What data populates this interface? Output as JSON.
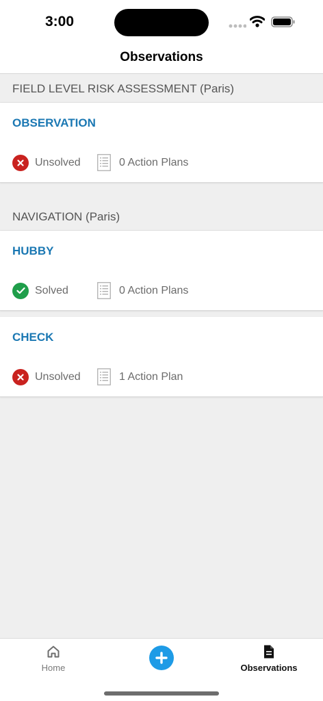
{
  "status_bar": {
    "time": "3:00"
  },
  "header": {
    "title": "Observations"
  },
  "colors": {
    "accent": "#1b78b3",
    "unsolved": "#c9221f",
    "solved": "#1f9e4a",
    "add_button": "#1e9be6"
  },
  "sections": [
    {
      "header": "FIELD LEVEL RISK ASSESSMENT (Paris)",
      "items": [
        {
          "title": "OBSERVATION",
          "status": "Unsolved",
          "status_icon": "x-circle-icon",
          "plans": "0 Action Plans"
        }
      ]
    },
    {
      "header": "NAVIGATION (Paris)",
      "items": [
        {
          "title": "HUBBY",
          "status": "Solved",
          "status_icon": "check-circle-icon",
          "plans": "0 Action Plans"
        },
        {
          "title": "CHECK",
          "status": "Unsolved",
          "status_icon": "x-circle-icon",
          "plans": "1 Action Plan"
        }
      ]
    }
  ],
  "tab_bar": {
    "home_label": "Home",
    "home_icon": "home-icon",
    "add_icon": "plus-icon",
    "observations_label": "Observations",
    "observations_icon": "document-icon"
  }
}
